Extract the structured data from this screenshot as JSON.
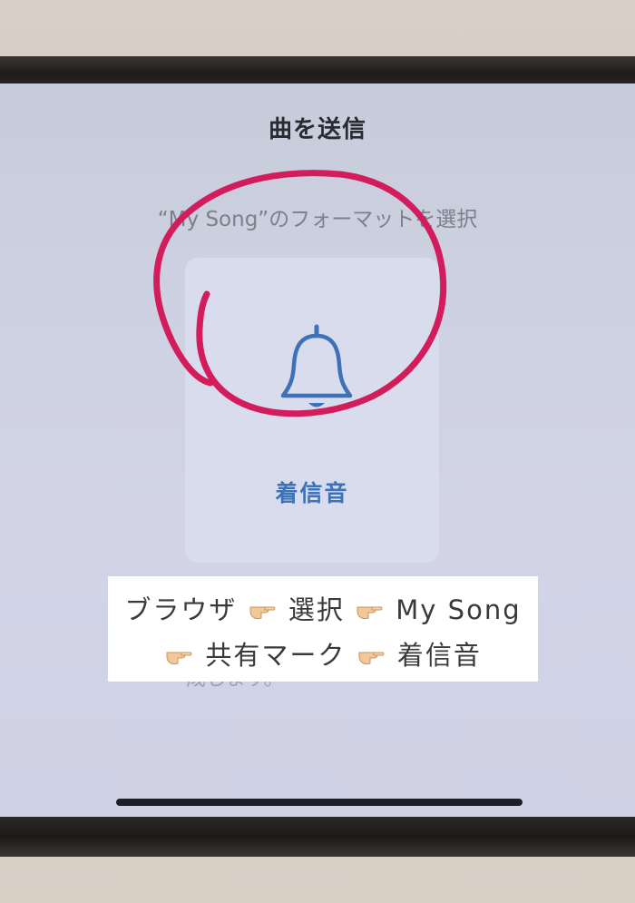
{
  "sheet": {
    "title": "曲を送信",
    "format_prompt": "“My Song”のフォーマットを選択",
    "options": [
      {
        "label": "着信音",
        "icon": "bell-icon"
      }
    ],
    "partially_hidden_text": "成します。"
  },
  "caption": {
    "steps": [
      "ブラウザ",
      "選択",
      "My Song",
      "共有マーク",
      "着信音"
    ],
    "pointer_icon": "pointing-hand-icon"
  },
  "colors": {
    "accent_blue": "#3d72b6",
    "annotation_pink": "#d31c5b",
    "screen_bg": "#cdd1e1"
  }
}
